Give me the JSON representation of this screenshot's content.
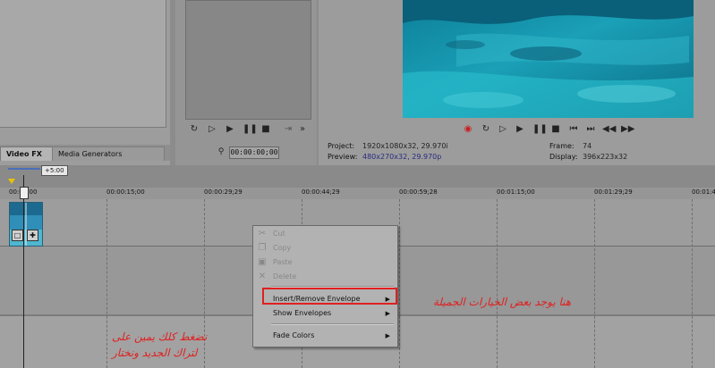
{
  "left_panel": {
    "tabs": [
      {
        "label": "Video FX"
      },
      {
        "label": "Media Generators"
      }
    ]
  },
  "trimmer": {
    "time": "00:00:00;00",
    "icons": [
      "loop-icon",
      "play-from-start-icon",
      "play-icon",
      "pause-icon",
      "stop-icon"
    ]
  },
  "preview": {
    "project_label": "Project:",
    "project_value": "1920x1080x32, 29.970i",
    "preview_label": "Preview:",
    "preview_value": "480x270x32, 29.970p",
    "frame_label": "Frame:",
    "frame_value": "74",
    "display_label": "Display:",
    "display_value": "396x223x32",
    "colors": {
      "water_dark": "#0a6f86",
      "water_light": "#3fc3d6"
    }
  },
  "timeline": {
    "loop_length": "+5:00",
    "ruler_ticks": [
      "00:00:00",
      "00:00:15;00",
      "00:00:29;29",
      "00:00:44;29",
      "00:00:59;28",
      "00:01:15;00",
      "00:01:29;29",
      "00:01:4"
    ]
  },
  "context_menu": {
    "items": [
      {
        "label": "Cut",
        "enabled": false,
        "icon": "scissors-icon"
      },
      {
        "label": "Copy",
        "enabled": false,
        "icon": "copy-icon"
      },
      {
        "label": "Paste",
        "enabled": false,
        "icon": "paste-icon"
      },
      {
        "label": "Delete",
        "enabled": false,
        "icon": "delete-icon"
      },
      {
        "label": "Insert/Remove Envelope",
        "enabled": true,
        "submenu": true
      },
      {
        "label": "Show Envelopes",
        "enabled": true,
        "submenu": true
      },
      {
        "label": "Fade Colors",
        "enabled": true,
        "submenu": true
      }
    ],
    "highlight_color": "#e12020"
  },
  "annotations": {
    "right_note": "هنا يوجد بعض الخيارات الجميلة",
    "left_note_line1": "نضغط كلك يمين على",
    "left_note_line2": "لتراك الجديد ونختار"
  }
}
